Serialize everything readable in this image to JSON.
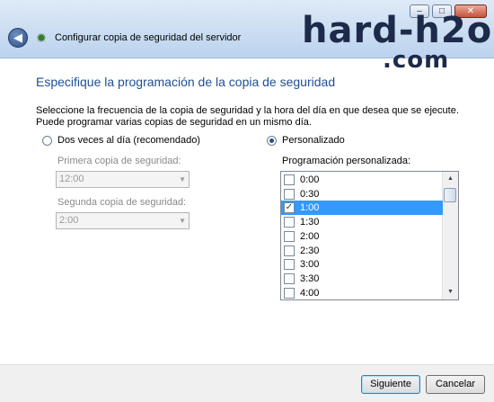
{
  "window": {
    "back_icon": "back-arrow-icon",
    "app_icon": "server-backup-icon",
    "title": "Configurar copia de seguridad del servidor",
    "controls": {
      "minimize": "–",
      "maximize": "□",
      "close": "✕"
    }
  },
  "watermark": {
    "line1": "hard-h2o",
    "line2": ".com"
  },
  "page": {
    "heading": "Especifique la programación de la copia de seguridad",
    "description_line1": "Seleccione la frecuencia de la copia de seguridad y la hora del día en que desea que se ejecute.",
    "description_line2": "Puede programar varias copias de seguridad en un mismo día."
  },
  "options": {
    "twice_daily": {
      "label": "Dos veces al día (recomendado)",
      "selected": false,
      "first_label": "Primera copia de seguridad:",
      "first_value": "12:00",
      "second_label": "Segunda copia de seguridad:",
      "second_value": "2:00"
    },
    "custom": {
      "label": "Personalizado",
      "selected": true,
      "list_label": "Programación personalizada:",
      "times": [
        {
          "time": "0:00",
          "checked": false,
          "selected": false
        },
        {
          "time": "0:30",
          "checked": false,
          "selected": false
        },
        {
          "time": "1:00",
          "checked": true,
          "selected": true
        },
        {
          "time": "1:30",
          "checked": false,
          "selected": false
        },
        {
          "time": "2:00",
          "checked": false,
          "selected": false
        },
        {
          "time": "2:30",
          "checked": false,
          "selected": false
        },
        {
          "time": "3:00",
          "checked": false,
          "selected": false
        },
        {
          "time": "3:30",
          "checked": false,
          "selected": false
        },
        {
          "time": "4:00",
          "checked": false,
          "selected": false
        }
      ]
    }
  },
  "buttons": {
    "next": "Siguiente",
    "cancel": "Cancelar"
  }
}
